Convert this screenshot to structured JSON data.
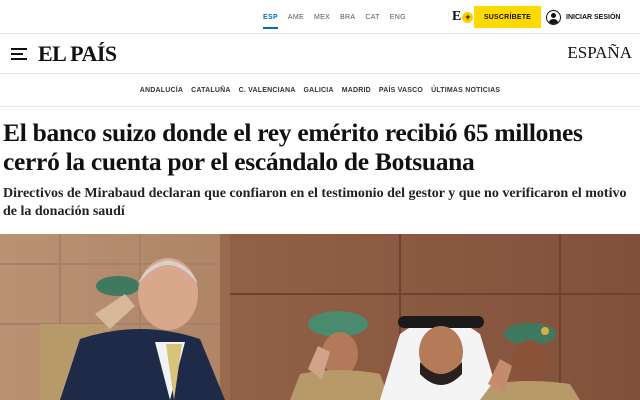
{
  "editions": [
    {
      "label": "ESP",
      "active": true
    },
    {
      "label": "AME",
      "active": false
    },
    {
      "label": "MEX",
      "active": false
    },
    {
      "label": "BRA",
      "active": false
    },
    {
      "label": "CAT",
      "active": false
    },
    {
      "label": "ENG",
      "active": false
    }
  ],
  "header": {
    "e_letter": "E",
    "e_plus": "+",
    "subscribe_label": "SUSCRÍBETE",
    "login_label": "INICIAR SESIÓN",
    "masthead": "EL PAÍS",
    "section": "ESPAÑA"
  },
  "regions": [
    "ANDALUCÍA",
    "CATALUÑA",
    "C. VALENCIANA",
    "GALICIA",
    "MADRID",
    "PAÍS VASCO",
    "ÚLTIMAS NOTICIAS"
  ],
  "article": {
    "headline": "El banco suizo donde el rey emérito recibió 65 millones cerró la cuenta por el escándalo de Botsuana",
    "subtitle": "Directivos de Mirabaud declaran que confiaron en el testimonio del gestor y que no verificaron el motivo de la donación saudí"
  },
  "colors": {
    "accent_blue": "#006dbd",
    "subscribe_yellow": "#ffda00"
  },
  "icons": {
    "menu": "hamburger-icon",
    "user": "user-icon"
  }
}
